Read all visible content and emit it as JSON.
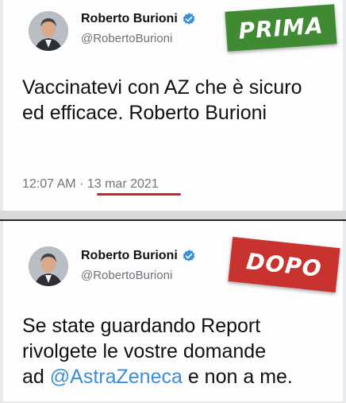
{
  "tweet_before": {
    "name": "Roberto Burioni",
    "handle": "@RobertoBurioni",
    "text": "Vaccinatevi con AZ che è sicuro ed efficace. Roberto Burioni",
    "time": "12:07 AM",
    "separator": "·",
    "date": "13 mar 2021",
    "stamp": "PRIMA",
    "stamp_color": "#3f8a32"
  },
  "tweet_after": {
    "name": "Roberto Burioni",
    "handle": "@RobertoBurioni",
    "text_line1": "Se state guardando Report",
    "text_line2": "rivolgete le vostre domande",
    "text_prefix": "ad ",
    "mention": "@AstraZeneca",
    "text_suffix": " e non a me.",
    "stamp": "DOPO",
    "stamp_color": "#c8322f"
  },
  "colors": {
    "verified_badge": "#3a8fd8",
    "mention": "#3a8fd8",
    "date_underline": "#c0282b"
  },
  "icons": {
    "verified": "verified-badge-icon",
    "avatar": "profile-avatar"
  }
}
